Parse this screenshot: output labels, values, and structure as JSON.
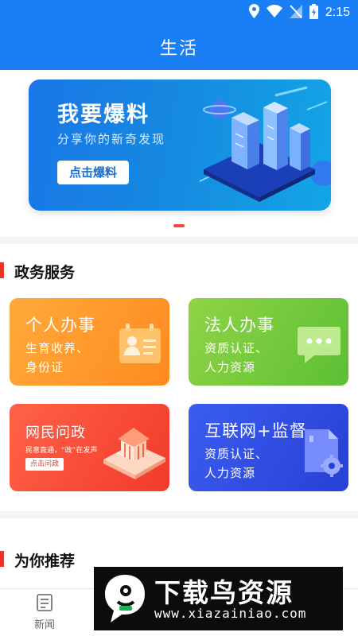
{
  "status_bar": {
    "time": "2:15",
    "icons": [
      "location-icon",
      "wifi-icon",
      "no-sim-icon",
      "battery-charging-icon"
    ]
  },
  "header": {
    "title": "生活"
  },
  "banner": {
    "title": "我要爆料",
    "subtitle": "分享你的新奇发现",
    "button_label": "点击爆料",
    "art": "isometric-city-illustration",
    "pager": {
      "current": 1,
      "total": 1
    }
  },
  "gov_services": {
    "title": "政务服务",
    "cards": [
      {
        "title": "个人办事",
        "desc_lines": [
          "生育收养、",
          "身份证"
        ],
        "icon": "id-card-icon",
        "colors": [
          "#ffa93a",
          "#ff8a1f"
        ]
      },
      {
        "title": "法人办事",
        "desc_lines": [
          "资质认证、",
          "人力资源"
        ],
        "icon": "chat-bubble-icon",
        "colors": [
          "#8fd445",
          "#5dbf34"
        ]
      },
      {
        "title": "网民问政",
        "small_text": "民意直通，“政”在发声",
        "button_label": "点击问政",
        "icon": "government-building-icon",
        "colors": [
          "#ff6246",
          "#f23a2c"
        ]
      },
      {
        "title": "互联网+监督",
        "desc_lines": [
          "资质认证、",
          "人力资源"
        ],
        "icon": "document-gear-icon",
        "colors": [
          "#3b5cf0",
          "#2740d6"
        ]
      }
    ]
  },
  "recommend": {
    "title": "为你推荐"
  },
  "tab_bar": {
    "items": [
      {
        "label": "新闻",
        "icon": "news-icon"
      }
    ]
  },
  "watermark": {
    "title": "下载鸟资源",
    "url": "www.xiazainiao.com"
  },
  "colors": {
    "primary": "#1a7ef5",
    "accent_red": "#e8352a",
    "divider": "#f4f4f4"
  }
}
